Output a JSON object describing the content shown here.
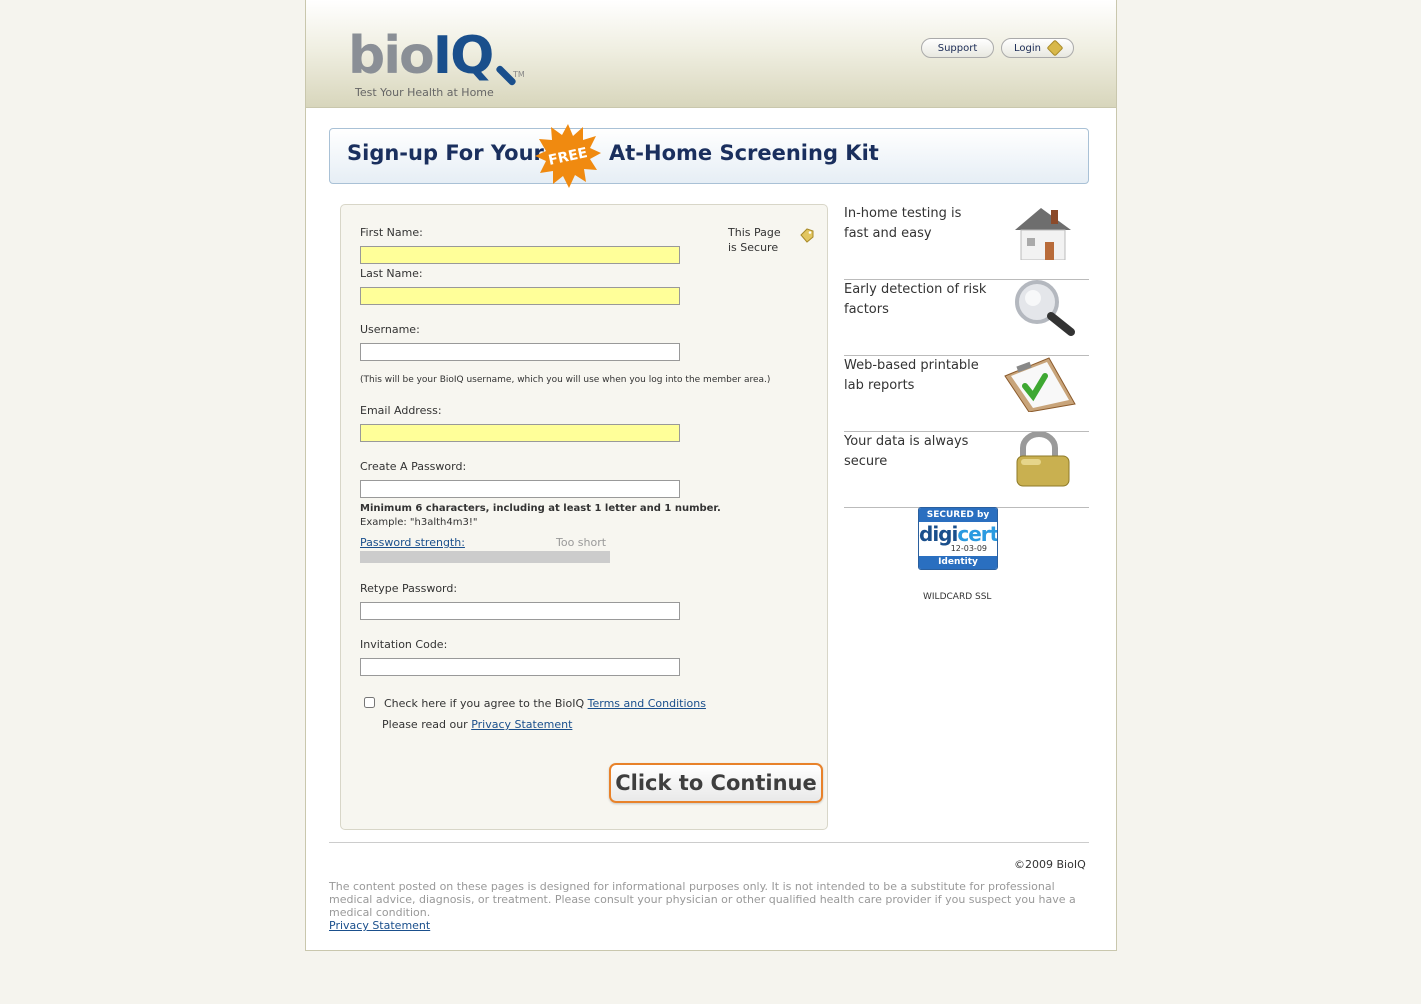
{
  "header": {
    "logo_text_a": "bio",
    "logo_text_b": "IQ",
    "logo_tm": "TM",
    "tagline": "Test Your Health at Home",
    "support_label": "Support",
    "login_label": "Login"
  },
  "banner": {
    "text_left": "Sign-up For Your",
    "burst_text": "FREE",
    "text_right": "At-Home Screening Kit"
  },
  "form": {
    "secure_line1": "This Page",
    "secure_line2": "is Secure",
    "first_name_label": "First Name:",
    "last_name_label": "Last Name:",
    "username_label": "Username:",
    "username_note": "(This will be your BioIQ username, which you will use when you log into the member area.)",
    "email_label": "Email Address:",
    "password_label": "Create A Password:",
    "password_rule": "Minimum 6 characters, including at least 1 letter and 1 number.",
    "password_example": "Example: \"h3alth4m3!\"",
    "strength_link": "Password strength:",
    "strength_status": "Too short",
    "strength_fraction": 0,
    "retype_label": "Retype Password:",
    "invite_label": "Invitation Code:",
    "agree_text": "Check here if you agree to the BioIQ",
    "terms_link": "Terms and Conditions",
    "privacy_text": "Please read our",
    "privacy_link": "Privacy Statement",
    "continue_label": "Click to Continue"
  },
  "features": [
    {
      "text": "In-home testing is fast and easy",
      "icon": "house-icon"
    },
    {
      "text": "Early detection of risk factors",
      "icon": "magnifier-icon"
    },
    {
      "text": "Web-based printable lab reports",
      "icon": "clipboard-check-icon"
    },
    {
      "text": "Your data is always secure",
      "icon": "padlock-icon"
    }
  ],
  "seal": {
    "top": "SECURED by",
    "brand_a": "digi",
    "brand_b": "cert",
    "date": "12-03-09",
    "bottom": "Identity Assured",
    "caption": "WILDCARD SSL"
  },
  "footer": {
    "copyright": "©2009 BioIQ",
    "disclaimer": "The content posted on these pages is designed for informational purposes only. It is not intended to be a substitute for professional medical advice, diagnosis, or treatment. Please consult your physician or other qualified health care provider if you suspect you have a medical condition.",
    "privacy_link": "Privacy Statement"
  },
  "colors": {
    "accent_navy": "#1a2f5e",
    "required_field": "#ffff99",
    "button_border": "#e8822a",
    "burst_orange": "#f08a10"
  }
}
